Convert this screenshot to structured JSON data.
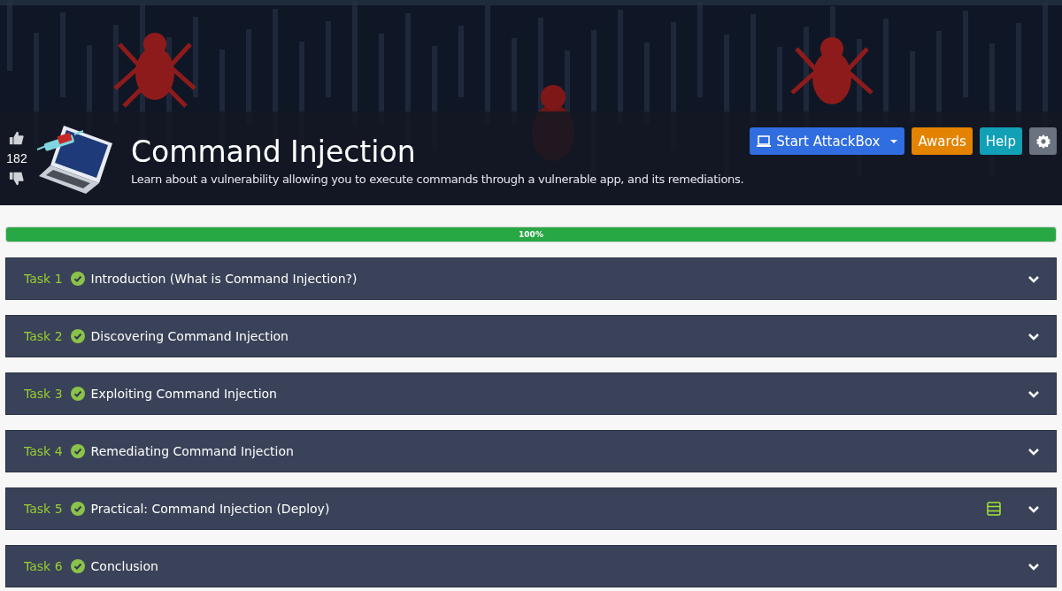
{
  "room": {
    "title": "Command Injection",
    "description": "Learn about a vulnerability allowing you to execute commands through a vulnerable app, and its remediations.",
    "votes": "182"
  },
  "header_buttons": [
    {
      "kind": "attackbox",
      "label": "Start AttackBox"
    },
    {
      "kind": "awards",
      "label": "Awards"
    },
    {
      "kind": "help",
      "label": "Help"
    },
    {
      "kind": "settings"
    }
  ],
  "progress": {
    "level": 1,
    "label": "100%"
  },
  "tasks": [
    {
      "number": "Task 1",
      "title": "Introduction (What is Command Injection?)",
      "completed": true,
      "has_machine": false,
      "expanded": false
    },
    {
      "number": "Task 2",
      "title": "Discovering Command Injection",
      "completed": true,
      "has_machine": false,
      "expanded": false
    },
    {
      "number": "Task 3",
      "title": "Exploiting Command Injection",
      "completed": true,
      "has_machine": false,
      "expanded": false
    },
    {
      "number": "Task 4",
      "title": "Remediating Command Injection",
      "completed": true,
      "has_machine": false,
      "expanded": false
    },
    {
      "number": "Task 5",
      "title": "Practical: Command Injection (Deploy)",
      "completed": true,
      "has_machine": true,
      "expanded": false
    },
    {
      "number": "Task 6",
      "title": "Conclusion",
      "completed": true,
      "has_machine": false,
      "expanded": false
    }
  ]
}
